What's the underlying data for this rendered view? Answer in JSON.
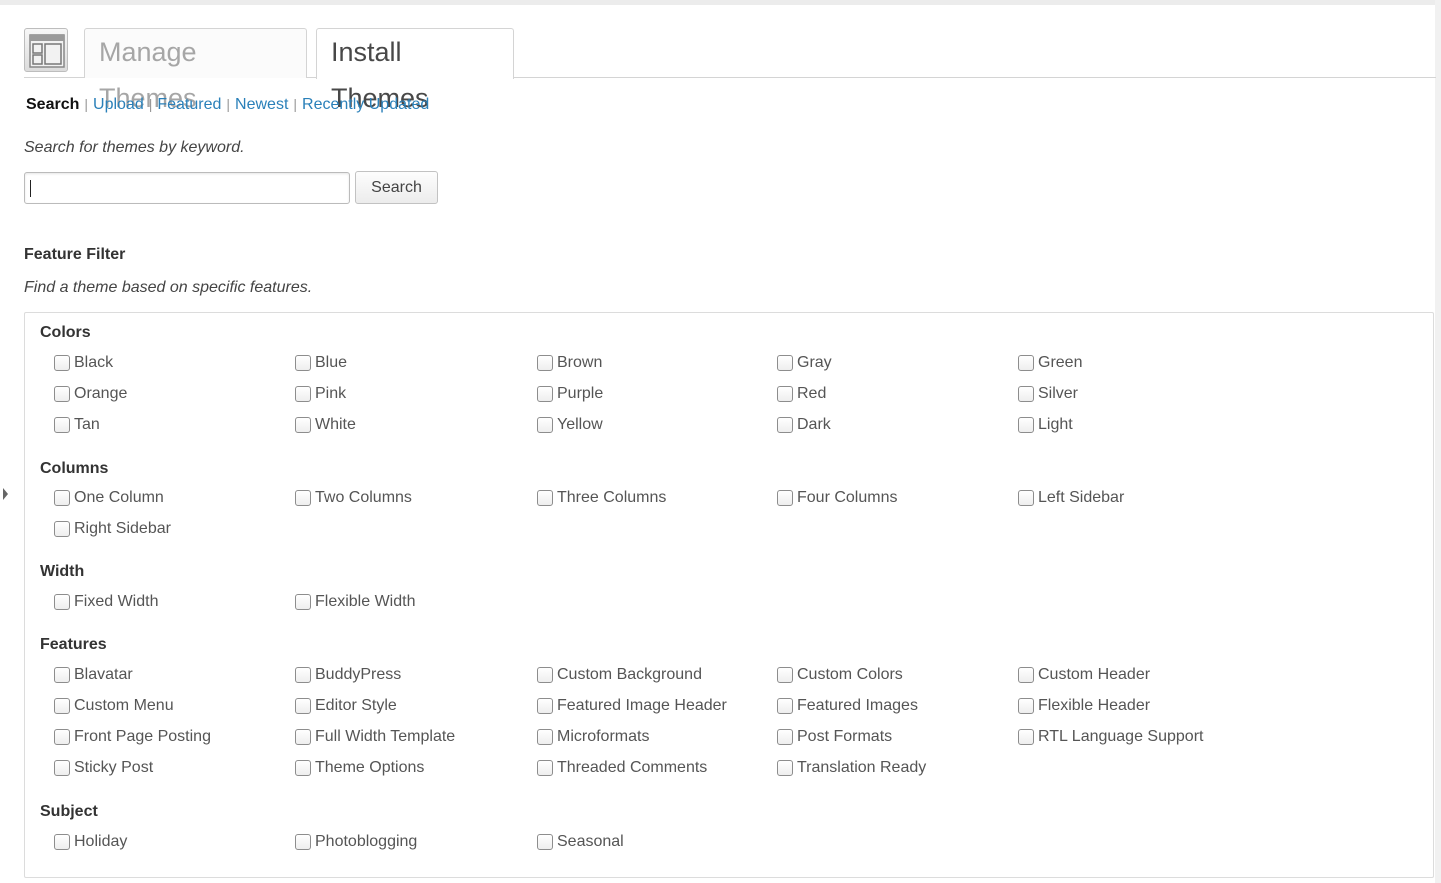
{
  "tabs": {
    "manage": "Manage Themes",
    "install": "Install Themes"
  },
  "subnav": {
    "current": "Search",
    "links": [
      "Upload",
      "Featured",
      "Newest",
      "Recently Updated"
    ]
  },
  "search": {
    "hint": "Search for themes by keyword.",
    "value": "",
    "button": "Search"
  },
  "feature_filter": {
    "title": "Feature Filter",
    "hint": "Find a theme based on specific features.",
    "groups": [
      {
        "title": "Colors",
        "options": [
          "Black",
          "Blue",
          "Brown",
          "Gray",
          "Green",
          "Orange",
          "Pink",
          "Purple",
          "Red",
          "Silver",
          "Tan",
          "White",
          "Yellow",
          "Dark",
          "Light"
        ]
      },
      {
        "title": "Columns",
        "options": [
          "One Column",
          "Two Columns",
          "Three Columns",
          "Four Columns",
          "Left Sidebar",
          "Right Sidebar"
        ]
      },
      {
        "title": "Width",
        "options": [
          "Fixed Width",
          "Flexible Width"
        ]
      },
      {
        "title": "Features",
        "options": [
          "Blavatar",
          "BuddyPress",
          "Custom Background",
          "Custom Colors",
          "Custom Header",
          "Custom Menu",
          "Editor Style",
          "Featured Image Header",
          "Featured Images",
          "Flexible Header",
          "Front Page Posting",
          "Full Width Template",
          "Microformats",
          "Post Formats",
          "RTL Language Support",
          "Sticky Post",
          "Theme Options",
          "Threaded Comments",
          "Translation Ready"
        ]
      },
      {
        "title": "Subject",
        "options": [
          "Holiday",
          "Photoblogging",
          "Seasonal"
        ]
      }
    ]
  },
  "colors": {
    "link": "#2a80b9",
    "text": "#333333",
    "border": "#dcdcdc"
  },
  "icons": {
    "header": "themes-layout-icon"
  }
}
